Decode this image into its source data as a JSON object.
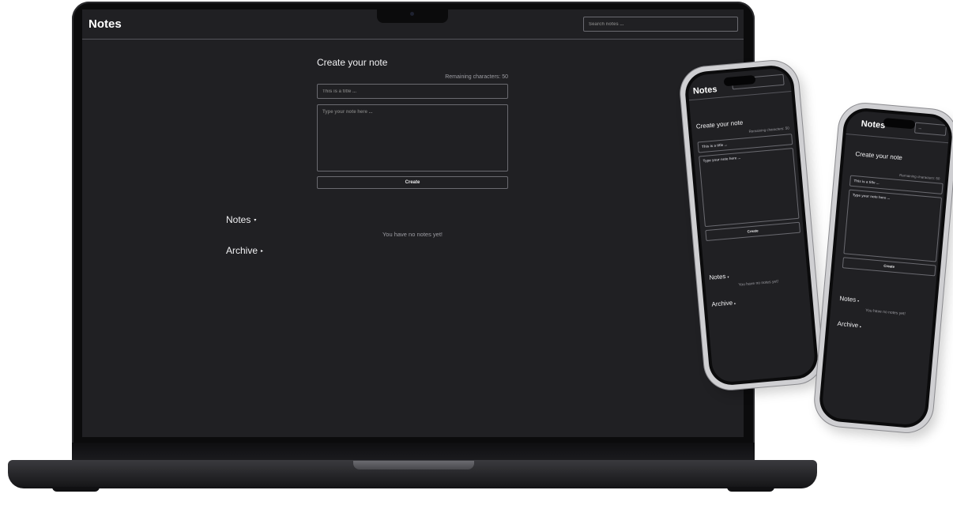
{
  "app": {
    "title": "Notes"
  },
  "search": {
    "placeholder": "Search notes ...",
    "short": "Search notes ..."
  },
  "form": {
    "heading": "Create your note",
    "remaining_label": "Remaining characters: 50",
    "title_placeholder": "This is a title ...",
    "body_placeholder": "Type your note here ...",
    "create_label": "Create"
  },
  "sections": {
    "notes_label": "Notes",
    "archive_label": "Archive",
    "notes_caret": "▾",
    "archive_caret": "▸"
  },
  "empty": {
    "message": "You have no notes yet!"
  },
  "phones": {
    "search_partial_1": "tes ...",
    "search_partial_2": "...",
    "remaining_partial_1": "Remaining characters: 50",
    "remaining_partial_2": "Remaining characters: 50"
  },
  "colors": {
    "background": "#202023",
    "border": "#6a6a70",
    "text": "#e8e8ea",
    "muted": "#9c9ca2"
  }
}
